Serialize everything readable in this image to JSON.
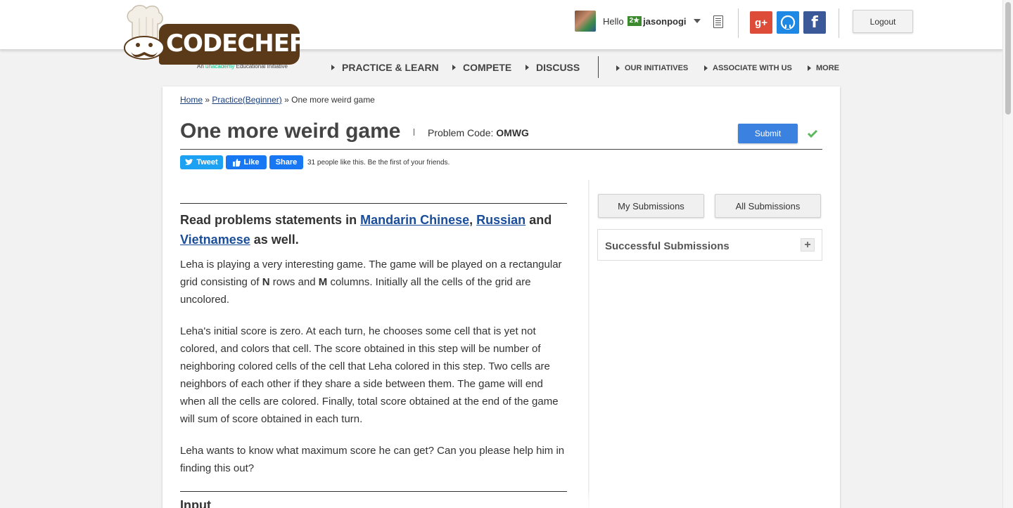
{
  "logo": {
    "wordmark": "CODECHEF",
    "tagline_prefix": "An",
    "tagline_brand": "unacademy",
    "tagline_suffix": "Educational Initiative"
  },
  "header": {
    "greeting": "Hello",
    "badge": "2★",
    "username": "jasonpogi",
    "logout_label": "Logout",
    "social": {
      "google": "g+",
      "facebook": "f"
    }
  },
  "nav": {
    "primary": [
      "PRACTICE & LEARN",
      "COMPETE",
      "DISCUSS"
    ],
    "secondary": [
      "OUR INITIATIVES",
      "ASSOCIATE WITH US",
      "MORE"
    ]
  },
  "breadcrumb": {
    "home": "Home",
    "section": "Practice(Beginner)",
    "sep1": "»",
    "sep2": "»",
    "current": "One more weird game"
  },
  "problem": {
    "title": "One more weird game",
    "code_label": "Problem Code:",
    "code": "OMWG",
    "submit_label": "Submit"
  },
  "share": {
    "tweet": "Tweet",
    "like": "Like",
    "share": "Share",
    "likes_text": "31 people like this. Be the first of your friends."
  },
  "statement": {
    "lang_prefix": "Read problems statements in",
    "lang1": "Mandarin Chinese",
    "comma": ",",
    "lang2": "Russian",
    "and": "and",
    "lang3": "Vietnamese",
    "lang_suffix": "as well.",
    "p1_a": "Leha is playing a very interesting game. The game will be played on a rectangular grid consisting of",
    "p1_n": "N",
    "p1_b": "rows and",
    "p1_m": "M",
    "p1_c": "columns. Initially all the cells of the grid are uncolored.",
    "p2": "Leha's initial score is zero. At each turn, he chooses some cell that is yet not colored, and colors that cell. The score obtained in this step will be number of neighboring colored cells of the cell that Leha colored in this step. Two cells are neighbors of each other if they share a side between them. The game will end when all the cells are colored. Finally, total score obtained at the end of the game will sum of score obtained in each turn.",
    "p3": "Leha wants to know what maximum score he can get? Can you please help him in finding this out?",
    "input_heading": "Input"
  },
  "sidebar": {
    "my_submissions": "My Submissions",
    "all_submissions": "All Submissions",
    "successful_submissions": "Successful Submissions",
    "expand": "+"
  }
}
